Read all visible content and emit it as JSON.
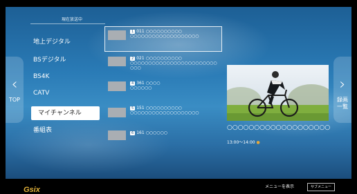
{
  "nav": {
    "left_label": "TOP",
    "right_label_line1": "録画",
    "right_label_line2": "一覧"
  },
  "status_label": "現在放送中",
  "menu": [
    {
      "label": "地上デジタル"
    },
    {
      "label": "BSデジタル"
    },
    {
      "label": "BS4K"
    },
    {
      "label": "CATV"
    },
    {
      "label": "マイチャンネル",
      "selected": true
    },
    {
      "label": "番組表"
    }
  ],
  "programs": [
    {
      "badge": "1",
      "channel": "011",
      "title": "○○○○○○○○○○",
      "subtitle": "○○○○○○○○○○○○○○○○○○○",
      "focused": true
    },
    {
      "badge": "2",
      "channel": "021",
      "title": "○○○○○○○○○○",
      "subtitle": "○○○○○○○○○○○○○○○○○○○○○○○○○○○"
    },
    {
      "badge": "4",
      "channel": "361",
      "title": "○○○○",
      "subtitle": "○○○○○○"
    },
    {
      "badge": "5",
      "channel": "151",
      "title": "○○○○○○○○○○",
      "subtitle": "○○○○○○○○○○○○○○○○○○○"
    },
    {
      "badge": "6",
      "channel": "161",
      "title": "○○○○○○",
      "subtitle": ""
    }
  ],
  "preview": {
    "title": "○○○○○○○○○○○○○○○○○○○",
    "time": "13:00～14:00"
  },
  "footer": {
    "logo_text": "Gsix",
    "menu_text": "メニューを表示",
    "key_label": "サブメニュー"
  }
}
